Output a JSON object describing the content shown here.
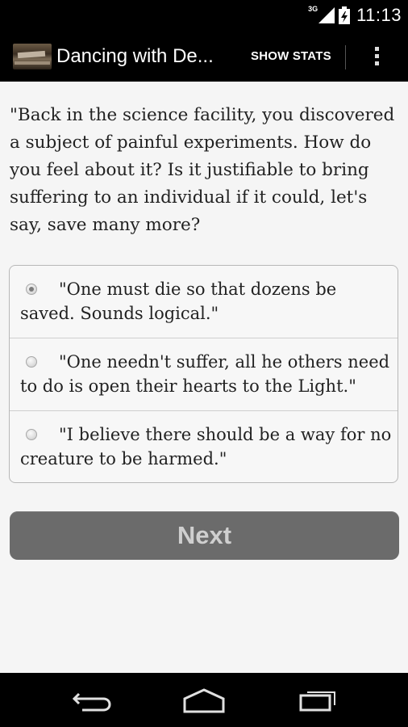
{
  "status_bar": {
    "network": "3G",
    "time": "11:13"
  },
  "action_bar": {
    "title": "Dancing with De...",
    "show_stats_label": "SHOW STATS"
  },
  "question": "\"Back in the science facility, you discovered a subject of painful experiments. How do you feel about it? Is it justifiable to bring suffering to an individual if it could, let's say, save many more?",
  "choices": [
    {
      "text": "\"One must die so that dozens be saved. Sounds logical.\"",
      "selected": true
    },
    {
      "text": "\"One needn't suffer, all he others need to do is open their hearts to the Light.\"",
      "selected": false
    },
    {
      "text": "\"I believe there should be a way for no creature to be harmed.\"",
      "selected": false
    }
  ],
  "next_button_label": "Next"
}
